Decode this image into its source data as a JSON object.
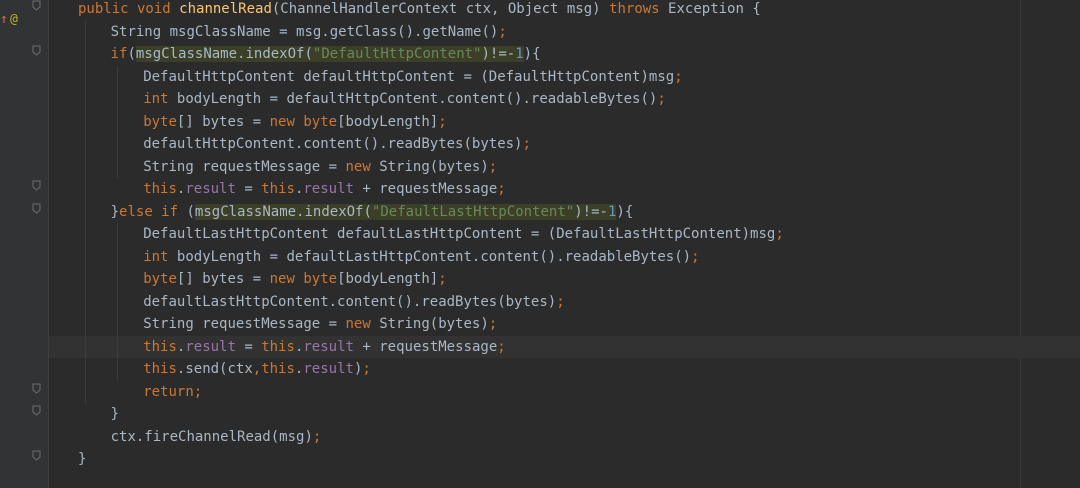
{
  "gutter": {
    "override_symbol": "↑",
    "annotation_symbol": "@"
  },
  "code_lines": [
    [
      [
        "kw",
        "public void "
      ],
      [
        "fn",
        "channelRead"
      ],
      [
        "p",
        "(ChannelHandlerContext ctx, Object msg) "
      ],
      [
        "kw",
        "throws "
      ],
      [
        "p",
        "Exception {"
      ]
    ],
    [
      [
        "p",
        "String msgClassName = msg.getClass().getName()"
      ],
      [
        "kw",
        ";"
      ]
    ],
    [
      [
        "kw",
        "if"
      ],
      [
        "p",
        "("
      ],
      [
        "hl",
        "msgClassName.indexOf("
      ],
      [
        "hls",
        "\"DefaultHttpContent\""
      ],
      [
        "hl",
        ")!=-"
      ],
      [
        "hln",
        "1"
      ],
      [
        "p",
        ")"
      ],
      [
        "p",
        "{"
      ]
    ],
    [
      [
        "p",
        "DefaultHttpContent defaultHttpContent = (DefaultHttpContent)msg"
      ],
      [
        "kw",
        ";"
      ]
    ],
    [
      [
        "kw",
        "int "
      ],
      [
        "p",
        "bodyLength = defaultHttpContent.content().readableBytes()"
      ],
      [
        "kw",
        ";"
      ]
    ],
    [
      [
        "kw",
        "byte"
      ],
      [
        "p",
        "[] bytes = "
      ],
      [
        "kw",
        "new byte"
      ],
      [
        "p",
        "[bodyLength]"
      ],
      [
        "kw",
        ";"
      ]
    ],
    [
      [
        "p",
        "defaultHttpContent.content().readBytes(bytes)"
      ],
      [
        "kw",
        ";"
      ]
    ],
    [
      [
        "p",
        "String requestMessage = "
      ],
      [
        "kw",
        "new "
      ],
      [
        "p",
        "String(bytes)"
      ],
      [
        "kw",
        ";"
      ]
    ],
    [
      [
        "kw",
        "this"
      ],
      [
        "p",
        "."
      ],
      [
        "fld",
        "result "
      ],
      [
        "p",
        "= "
      ],
      [
        "kw",
        "this"
      ],
      [
        "p",
        "."
      ],
      [
        "fld",
        "result "
      ],
      [
        "p",
        "+ requestMessage"
      ],
      [
        "kw",
        ";"
      ]
    ],
    [
      [
        "p",
        "}"
      ],
      [
        "kw",
        "else if "
      ],
      [
        "p",
        "("
      ],
      [
        "hl",
        "msgClassName.indexOf("
      ],
      [
        "hls",
        "\"DefaultLastHttpContent\""
      ],
      [
        "hl",
        ")!=-"
      ],
      [
        "hln",
        "1"
      ],
      [
        "p",
        ")"
      ],
      [
        "p",
        "{"
      ]
    ],
    [
      [
        "p",
        "DefaultLastHttpContent defaultLastHttpContent = (DefaultLastHttpContent)msg"
      ],
      [
        "kw",
        ";"
      ]
    ],
    [
      [
        "kw",
        "int "
      ],
      [
        "p",
        "bodyLength = defaultLastHttpContent.content().readableBytes()"
      ],
      [
        "kw",
        ";"
      ]
    ],
    [
      [
        "kw",
        "byte"
      ],
      [
        "p",
        "[] bytes = "
      ],
      [
        "kw",
        "new byte"
      ],
      [
        "p",
        "[bodyLength]"
      ],
      [
        "kw",
        ";"
      ]
    ],
    [
      [
        "p",
        "defaultLastHttpContent.content().readBytes(bytes)"
      ],
      [
        "kw",
        ";"
      ]
    ],
    [
      [
        "p",
        "String requestMessage = "
      ],
      [
        "kw",
        "new "
      ],
      [
        "p",
        "String(bytes)"
      ],
      [
        "kw",
        ";"
      ]
    ],
    [
      [
        "kw",
        "this"
      ],
      [
        "p",
        "."
      ],
      [
        "fld",
        "result "
      ],
      [
        "p",
        "= "
      ],
      [
        "kw",
        "this"
      ],
      [
        "p",
        "."
      ],
      [
        "fld",
        "result "
      ],
      [
        "p",
        "+ requestMessage"
      ],
      [
        "kw",
        ";"
      ]
    ],
    [
      [
        "kw",
        "this"
      ],
      [
        "p",
        ".send(ctx"
      ],
      [
        "kw",
        ","
      ],
      [
        "kw",
        "this"
      ],
      [
        "p",
        "."
      ],
      [
        "fld",
        "result"
      ],
      [
        "p",
        ")"
      ],
      [
        "kw",
        ";"
      ]
    ],
    [
      [
        "kw",
        "return;"
      ]
    ],
    [
      [
        "p",
        "}"
      ]
    ],
    [
      [
        "p",
        "ctx.fireChannelRead(msg)"
      ],
      [
        "kw",
        ";"
      ]
    ],
    [
      [
        "p",
        "}"
      ]
    ]
  ],
  "colors": {
    "background": "#2b2b2b",
    "keyword": "#cc7832",
    "method_declaration": "#ffc66d",
    "field": "#9876aa",
    "string": "#6a8759",
    "number": "#6897bb",
    "plain": "#a9b7c6"
  },
  "icons": {
    "override": "overrides-method-icon",
    "annotation": "annotation-icon",
    "fold": "fold-marker-icon"
  }
}
